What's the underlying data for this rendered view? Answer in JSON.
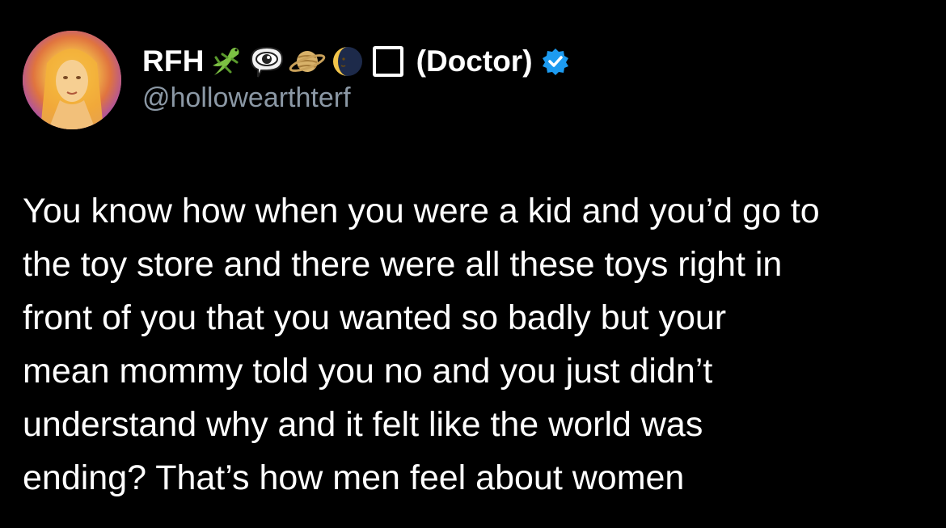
{
  "tweet": {
    "author": {
      "display_name": "RFH",
      "status_emojis": [
        "lizard-icon",
        "eye-in-speech-bubble-icon",
        "ringed-planet-icon",
        "crescent-moon-face-icon",
        "black-square-icon"
      ],
      "title": "(Doctor)",
      "verified": true,
      "handle": "@hollowearthterf"
    },
    "text_lines": [
      "You know how when you were a kid and you’d go to",
      "the toy store and there were all these toys right in",
      "front of you that you wanted so badly but your",
      "mean mommy told you no and you just didn’t",
      "understand why and it felt like the world was",
      "ending? That’s how men feel about women"
    ]
  },
  "colors": {
    "background": "#000000",
    "text": "#ffffff",
    "handle": "#8b98a5",
    "verified_badge": "#1d9bf0"
  }
}
